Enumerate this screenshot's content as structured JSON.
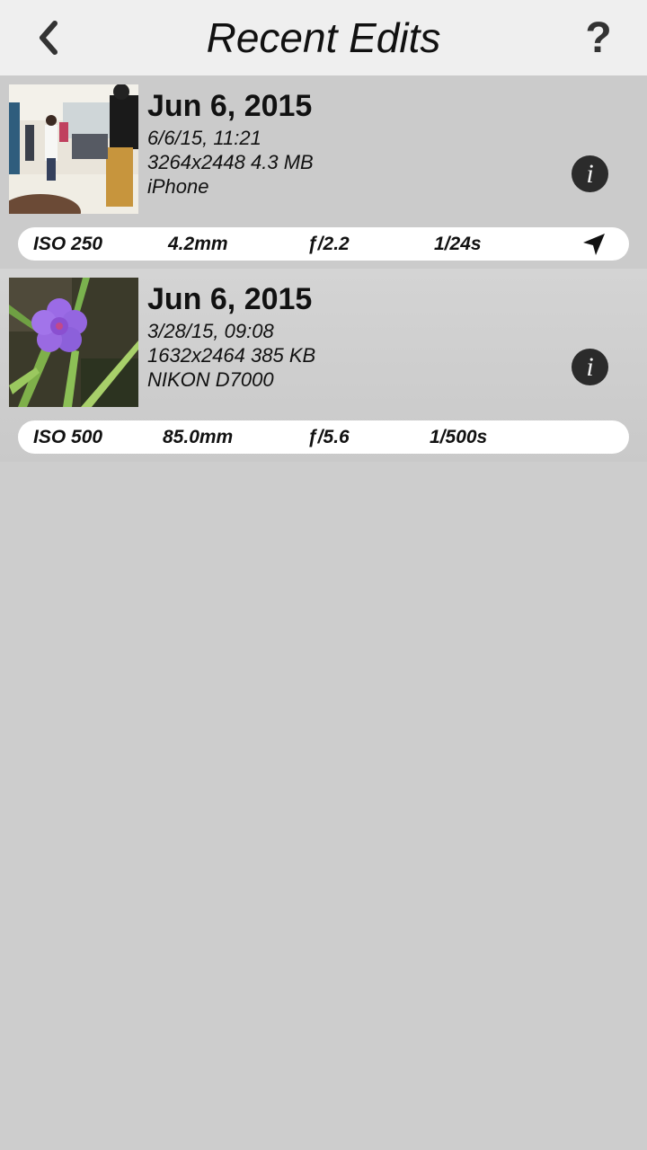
{
  "header": {
    "title": "Recent Edits",
    "help_label": "?"
  },
  "photos": [
    {
      "date": "Jun 6, 2015",
      "timestamp": "6/6/15, 11:21",
      "dimensions_size": "3264x2448 4.3 MB",
      "camera": "iPhone",
      "info_label": "i",
      "exif": {
        "iso": "ISO 250",
        "focal": "4.2mm",
        "aperture": "ƒ/2.2",
        "shutter": "1/24s"
      },
      "has_location": true
    },
    {
      "date": "Jun 6, 2015",
      "timestamp": "3/28/15, 09:08",
      "dimensions_size": "1632x2464 385 KB",
      "camera": "NIKON D7000",
      "info_label": "i",
      "exif": {
        "iso": "ISO 500",
        "focal": "85.0mm",
        "aperture": "ƒ/5.6",
        "shutter": "1/500s"
      },
      "has_location": false
    }
  ],
  "icons": {
    "back": "chevron-left-icon",
    "help": "question-mark-icon",
    "info": "info-icon",
    "location": "location-arrow-icon"
  },
  "colors": {
    "background": "#cdcdcd",
    "topbar": "#efefef",
    "info_button": "#2b2b2b",
    "exif_bar": "#ffffff"
  }
}
